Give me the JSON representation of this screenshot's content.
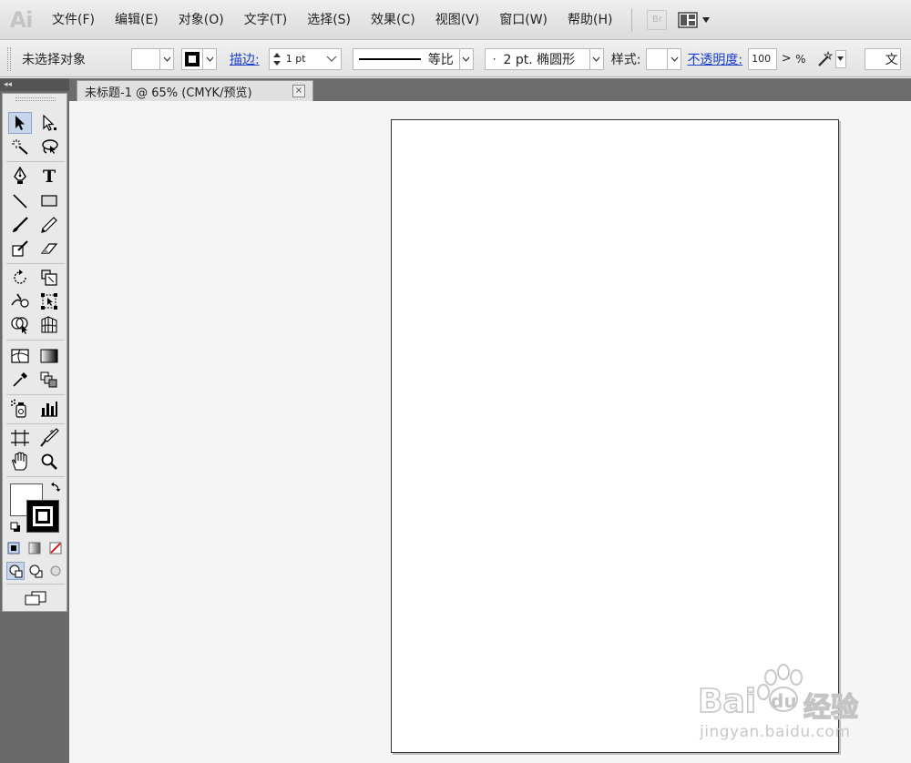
{
  "app": {
    "logo": "Ai"
  },
  "menu": [
    {
      "label": "文件(F)"
    },
    {
      "label": "编辑(E)"
    },
    {
      "label": "对象(O)"
    },
    {
      "label": "文字(T)"
    },
    {
      "label": "选择(S)"
    },
    {
      "label": "效果(C)"
    },
    {
      "label": "视图(V)"
    },
    {
      "label": "窗口(W)"
    },
    {
      "label": "帮助(H)"
    }
  ],
  "bridge_button": "Br",
  "control": {
    "selection_status": "未选择对象",
    "stroke_label": "描边:",
    "stroke_weight": "1 pt",
    "profile_label": "等比",
    "brush_label": "2 pt. 椭圆形",
    "brush_dot": "·",
    "style_label": "样式:",
    "opacity_label": "不透明度:",
    "opacity_value": "100",
    "opacity_arrow": ">",
    "percent": "%",
    "doc_setup": "文"
  },
  "document": {
    "tab_title": "未标题-1 @ 65% (CMYK/预览)",
    "close": "×"
  },
  "tools_header": "◂◂",
  "watermark": {
    "brand_latin": "Bai",
    "brand_du": "du",
    "brand_cn": "经验",
    "url": "jingyan.baidu.com"
  },
  "colors": {
    "link": "#1a3fcc",
    "chrome_dark": "#6a6a6a",
    "canvas": "#f5f5f5",
    "artboard": "#ffffff"
  }
}
